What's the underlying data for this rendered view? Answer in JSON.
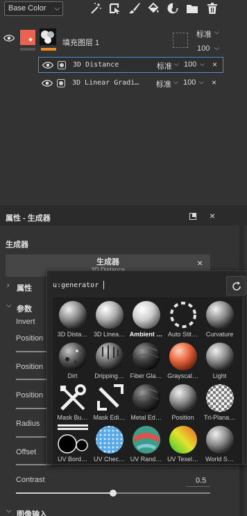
{
  "toolbar": {
    "channel": "Base Color",
    "icons": [
      "magic-wand-icon",
      "transform-icon",
      "brush-icon",
      "fill-icon",
      "generator-icon",
      "folder-icon",
      "trash-icon"
    ]
  },
  "layers": {
    "fill_layer": {
      "name": "填充图层 1",
      "blend": "标准",
      "opacity": "100",
      "swatch_color": "#e8644e",
      "accent": "#e98a2d"
    },
    "effects": [
      {
        "name": "3D Distance",
        "blend": "标准",
        "opacity": "100"
      },
      {
        "name": "3D Linear Gradi…",
        "blend": "标准",
        "opacity": "100"
      }
    ]
  },
  "properties": {
    "title": "属性 - 生成器",
    "section": "生成器",
    "generator_title": "生成器",
    "generator_sub": "3D Distance",
    "subsections": {
      "attributes": "属性",
      "params": "参数",
      "image_inputs": "图像输入"
    },
    "params": [
      "Invert",
      "Position",
      "Position",
      "Position",
      "Radius",
      "Offset",
      "Contrast"
    ],
    "contrast_value": "0.5",
    "contrast_level": 0.5
  },
  "popup": {
    "query": "u:generator",
    "items": [
      {
        "label": "3D Dista…",
        "thumb": "sphere-gray"
      },
      {
        "label": "3D Linea…",
        "thumb": "sphere-light"
      },
      {
        "label": "Ambient …",
        "thumb": "sphere-white"
      },
      {
        "label": "Auto Stit…",
        "thumb": "dashed-ring"
      },
      {
        "label": "Curvature",
        "thumb": "sphere-gray"
      },
      {
        "label": "Dirt",
        "thumb": "sphere-dirty"
      },
      {
        "label": "Dripping…",
        "thumb": "sphere-drip"
      },
      {
        "label": "Fiber Gla…",
        "thumb": "sphere-dark"
      },
      {
        "label": "Grayscal…",
        "thumb": "sphere-orange"
      },
      {
        "label": "Light",
        "thumb": "sphere-gray"
      },
      {
        "label": "Mask Bu…",
        "thumb": "tools"
      },
      {
        "label": "Mask Edi…",
        "thumb": "edit"
      },
      {
        "label": "Metal Ed…",
        "thumb": "sphere-dark"
      },
      {
        "label": "Position",
        "thumb": "sphere-gray"
      },
      {
        "label": "Tri-Plana…",
        "thumb": "sphere-checker"
      },
      {
        "label": "UV Bord…",
        "thumb": "dots"
      },
      {
        "label": "UV Chec…",
        "thumb": "sphere-blue"
      },
      {
        "label": "UV Rand…",
        "thumb": "sphere-random"
      },
      {
        "label": "UV Texel…",
        "thumb": "sphere-rainbow"
      },
      {
        "label": "World S…",
        "thumb": "sphere-gray"
      }
    ],
    "selected_index": 2
  }
}
